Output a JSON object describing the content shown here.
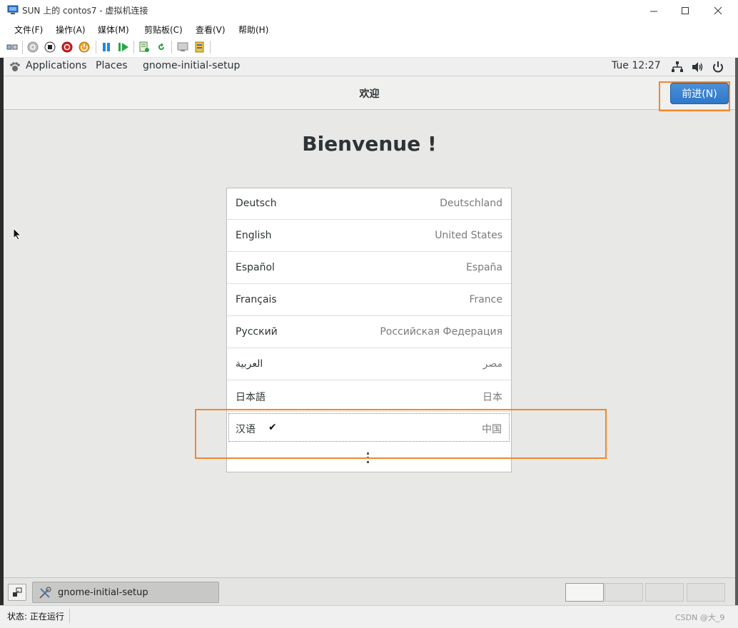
{
  "window": {
    "title": "SUN 上的 contos7 - 虚拟机连接"
  },
  "menubar": {
    "items": [
      "文件(F)",
      "操作(A)",
      "媒体(M)",
      "剪贴板(C)",
      "查看(V)",
      "帮助(H)"
    ]
  },
  "toolbar": {
    "icons": [
      "ctrl-alt-del-icon",
      "start-icon",
      "turn-off-icon",
      "shut-down-icon",
      "power-icon",
      "pause-icon",
      "resume-icon",
      "checkpoint-icon",
      "revert-icon",
      "enhanced-session-icon",
      "settings-icon"
    ]
  },
  "gnome_topbar": {
    "applications": "Applications",
    "places": "Places",
    "app_name": "gnome-initial-setup",
    "clock": "Tue 12:27"
  },
  "headerbar": {
    "title": "欢迎",
    "next_label": "前进(N)"
  },
  "main": {
    "heading": "Bienvenue !",
    "languages": [
      {
        "name": "Deutsch",
        "region": "Deutschland",
        "selected": false
      },
      {
        "name": "English",
        "region": "United States",
        "selected": false
      },
      {
        "name": "Español",
        "region": "España",
        "selected": false
      },
      {
        "name": "Français",
        "region": "France",
        "selected": false
      },
      {
        "name": "Русский",
        "region": "Российская Федерация",
        "selected": false
      },
      {
        "name": "العربية",
        "region": "مصر",
        "selected": false
      },
      {
        "name": "日本語",
        "region": "日本",
        "selected": false
      },
      {
        "name": "汉语",
        "region": "中国",
        "selected": true
      }
    ],
    "check_mark": "✔"
  },
  "taskbar": {
    "window_label": "gnome-initial-setup"
  },
  "statusbar": {
    "status": "状态: 正在运行",
    "watermark": "CSDN @大_9"
  },
  "colors": {
    "accent": "#3584e4",
    "highlight": "#f0882d"
  }
}
